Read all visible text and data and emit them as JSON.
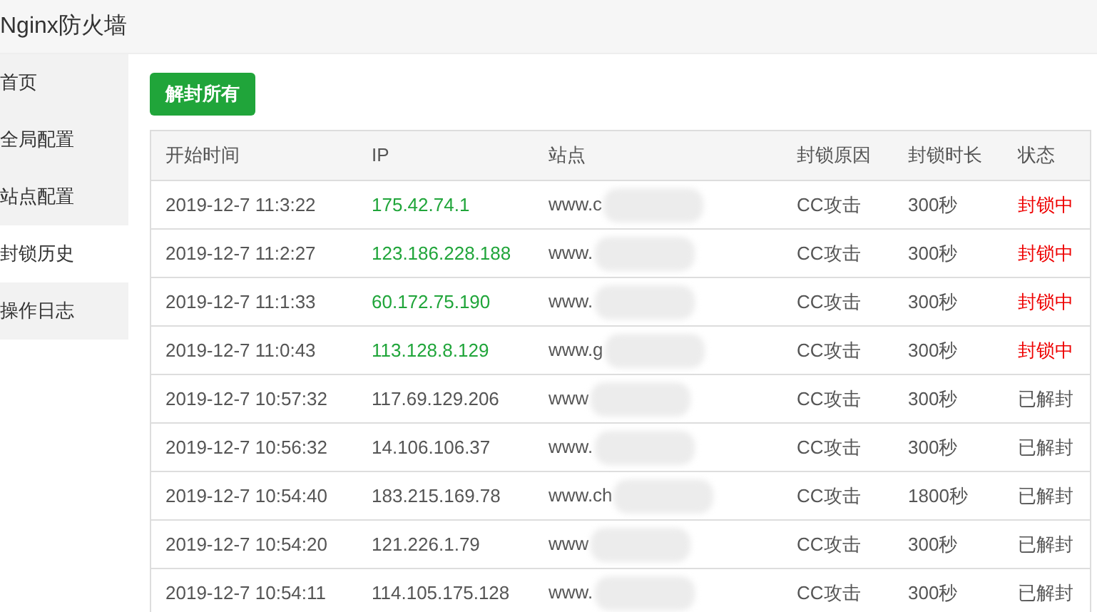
{
  "window": {
    "title": "Nginx防火墙"
  },
  "sidebar": {
    "items": [
      {
        "label": "首页",
        "selected": false
      },
      {
        "label": "全局配置",
        "selected": false
      },
      {
        "label": "站点配置",
        "selected": false
      },
      {
        "label": "封锁历史",
        "selected": true
      },
      {
        "label": "操作日志",
        "selected": false
      }
    ]
  },
  "unblock_all_button": "解封所有",
  "table": {
    "columns": [
      "开始时间",
      "IP",
      "站点",
      "封锁原因",
      "封锁时长",
      "状态"
    ],
    "rows": [
      {
        "start_time": "2019-12-7 11:3:22",
        "ip": "175.42.74.1",
        "site": "www.c",
        "reason": "CC攻击",
        "duration": "300秒",
        "status": "封锁中",
        "blocked": true
      },
      {
        "start_time": "2019-12-7 11:2:27",
        "ip": "123.186.228.188",
        "site": "www.",
        "reason": "CC攻击",
        "duration": "300秒",
        "status": "封锁中",
        "blocked": true
      },
      {
        "start_time": "2019-12-7 11:1:33",
        "ip": "60.172.75.190",
        "site": "www.",
        "reason": "CC攻击",
        "duration": "300秒",
        "status": "封锁中",
        "blocked": true
      },
      {
        "start_time": "2019-12-7 11:0:43",
        "ip": "113.128.8.129",
        "site": "www.g",
        "reason": "CC攻击",
        "duration": "300秒",
        "status": "封锁中",
        "blocked": true
      },
      {
        "start_time": "2019-12-7 10:57:32",
        "ip": "117.69.129.206",
        "site": "www",
        "reason": "CC攻击",
        "duration": "300秒",
        "status": "已解封",
        "blocked": false
      },
      {
        "start_time": "2019-12-7 10:56:32",
        "ip": "14.106.106.37",
        "site": "www.",
        "reason": "CC攻击",
        "duration": "300秒",
        "status": "已解封",
        "blocked": false
      },
      {
        "start_time": "2019-12-7 10:54:40",
        "ip": "183.215.169.78",
        "site": "www.ch",
        "reason": "CC攻击",
        "duration": "1800秒",
        "status": "已解封",
        "blocked": false
      },
      {
        "start_time": "2019-12-7 10:54:20",
        "ip": "121.226.1.79",
        "site": "www",
        "reason": "CC攻击",
        "duration": "300秒",
        "status": "已解封",
        "blocked": false
      },
      {
        "start_time": "2019-12-7 10:54:11",
        "ip": "114.105.175.128",
        "site": "www.",
        "reason": "CC攻击",
        "duration": "300秒",
        "status": "已解封",
        "blocked": false
      }
    ]
  }
}
